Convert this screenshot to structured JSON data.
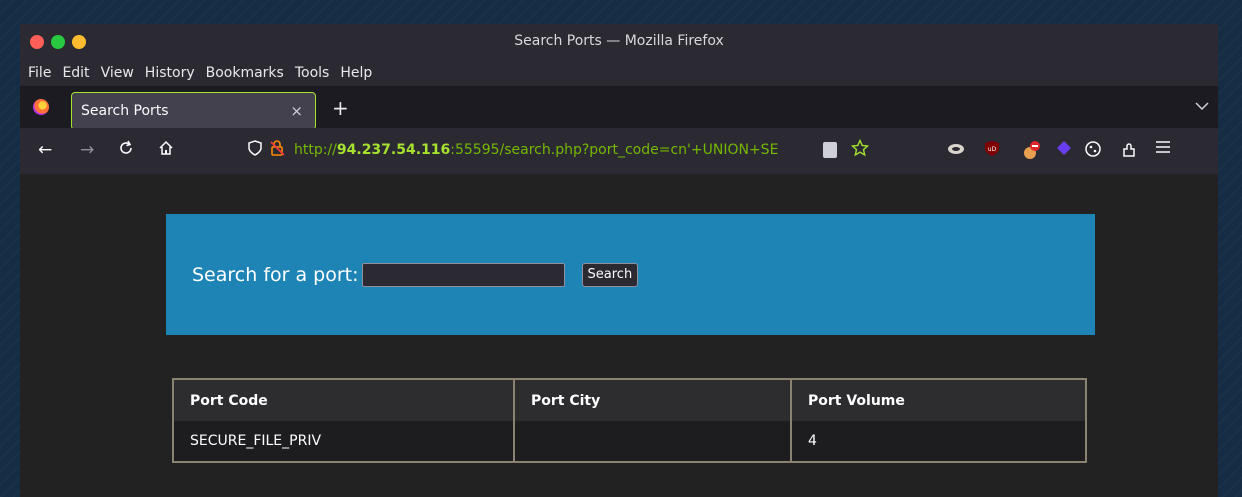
{
  "window": {
    "title": "Search Ports — Mozilla Firefox"
  },
  "menubar": {
    "items": [
      "File",
      "Edit",
      "View",
      "History",
      "Bookmarks",
      "Tools",
      "Help"
    ]
  },
  "tab": {
    "title": "Search Ports",
    "close": "×",
    "new_tab": "+",
    "list": "⌄"
  },
  "navbar": {
    "back": "←",
    "forward": "→",
    "reload": "C",
    "home": "⌂",
    "url_scheme": "http://",
    "url_host": "94.237.54.116",
    "url_rest": ":55595/search.php?port_code=cn'+UNION+SE"
  },
  "page": {
    "search_label": "Search for a port:",
    "search_value": "",
    "search_button": "Search",
    "table": {
      "headers": [
        "Port Code",
        "Port City",
        "Port Volume"
      ],
      "rows": [
        [
          "SECURE_FILE_PRIV",
          "",
          "4"
        ]
      ]
    }
  },
  "colors": {
    "accent": "#a6e22e",
    "hero": "#1d84b5",
    "url_text": "#75b800"
  },
  "icons": [
    "firefox-icon",
    "shield-icon",
    "lock-warning-icon",
    "reader-view-icon",
    "bookmark-star-icon",
    "extensions-icon",
    "menu-icon"
  ]
}
